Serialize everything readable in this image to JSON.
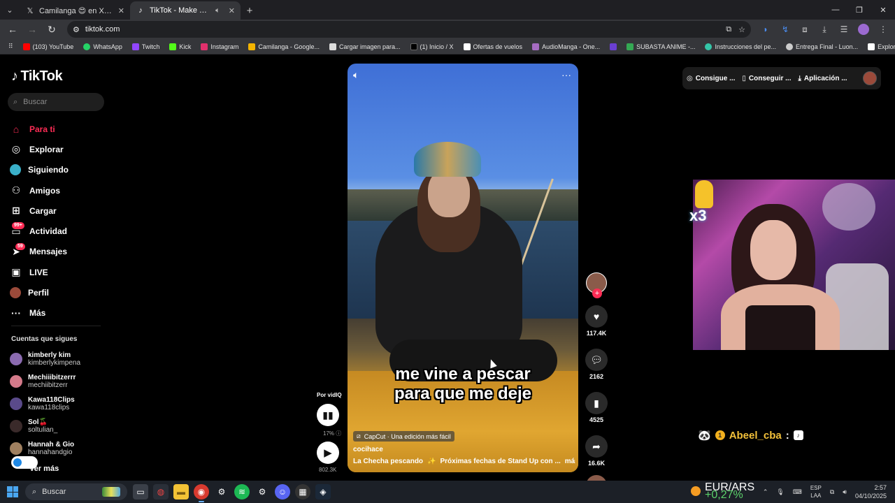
{
  "browser": {
    "tabs": [
      {
        "label": "Camilanga 😍 en X: \"las nudes",
        "icon": "x-logo-icon",
        "active": false
      },
      {
        "label": "TikTok - Make Your Day",
        "icon": "tiktok-icon",
        "active": true
      }
    ],
    "url": "tiktok.com",
    "bookmarks": [
      {
        "label": "(103) YouTube",
        "color": "#ff0000"
      },
      {
        "label": "WhatsApp",
        "color": "#25d366"
      },
      {
        "label": "Twitch",
        "color": "#9146ff"
      },
      {
        "label": "Kick",
        "color": "#53fc18"
      },
      {
        "label": "Instagram",
        "color": "#e1306c"
      },
      {
        "label": "Camilanga - Google...",
        "color": "#f4b400"
      },
      {
        "label": "Cargar imagen para...",
        "color": "#dddddd"
      },
      {
        "label": "(1) Inicio / X",
        "color": "#000000"
      },
      {
        "label": "Ofertas de vuelos",
        "color": "#ffffff"
      },
      {
        "label": "AudioManga - One...",
        "color": "#a56cc1"
      },
      {
        "label": "",
        "color": "#6a3fd1"
      },
      {
        "label": "SUBASTA ANIME -...",
        "color": "#34a853"
      },
      {
        "label": "Instrucciones del pe...",
        "color": "#34c6a8"
      },
      {
        "label": "Entrega Final - Luon...",
        "color": "#cccccc"
      },
      {
        "label": "Explorar | Patreon",
        "color": "#ffffff"
      }
    ]
  },
  "tiktok": {
    "logo": "TikTok",
    "search_placeholder": "Buscar",
    "nav": [
      {
        "label": "Para ti",
        "icon": "home-icon",
        "active": true,
        "badge": ""
      },
      {
        "label": "Explorar",
        "icon": "compass-icon",
        "active": false,
        "badge": ""
      },
      {
        "label": "Siguiendo",
        "icon": "following-icon",
        "active": false,
        "badge": ""
      },
      {
        "label": "Amigos",
        "icon": "friends-icon",
        "active": false,
        "badge": ""
      },
      {
        "label": "Cargar",
        "icon": "upload-icon",
        "active": false,
        "badge": ""
      },
      {
        "label": "Actividad",
        "icon": "activity-icon",
        "active": false,
        "badge": "99+"
      },
      {
        "label": "Mensajes",
        "icon": "messages-icon",
        "active": false,
        "badge": "59"
      },
      {
        "label": "LIVE",
        "icon": "live-icon",
        "active": false,
        "badge": ""
      },
      {
        "label": "Perfil",
        "icon": "profile-icon",
        "active": false,
        "badge": ""
      },
      {
        "label": "Más",
        "icon": "more-icon",
        "active": false,
        "badge": ""
      }
    ],
    "following_heading": "Cuentas que sigues",
    "following": [
      {
        "name": "kimberly kim",
        "handle": "kimberlykimpena",
        "color": "#8b6bb0"
      },
      {
        "name": "Mechiiibitzerrr",
        "handle": "mechiibitzerr",
        "color": "#d47a8a"
      },
      {
        "name": "Kawa118Clips",
        "handle": "kawa118clips",
        "color": "#5a4a8a"
      },
      {
        "name": "Sol🍒",
        "handle": "soltulian_",
        "color": "#2a1a1a"
      },
      {
        "name": "Hannah & Gio",
        "handle": "hannahandgio",
        "color": "#a08060"
      }
    ],
    "see_more": "Ver más",
    "top_actions": [
      "Consigue ...",
      "Conseguir ...",
      "Aplicación ..."
    ],
    "video": {
      "caption_line1": "me vine a pescar",
      "caption_line2": "para que me deje",
      "capcut": "CapCut · Una edición más fácil",
      "author": "cocihace",
      "description_1": "La Checha pescando",
      "description_2": "Próximas fechas de Stand Up con ...",
      "more": "más"
    },
    "actions": {
      "likes": "117.4K",
      "comments": "2162",
      "saves": "4525",
      "shares": "16.6K"
    },
    "vidiq": {
      "label": "Por vidIQ",
      "percent": "17%",
      "views": "802.3K"
    }
  },
  "stream_overlay": {
    "multiplier": "x3",
    "chat_user": "Abeel_cba",
    "chat_sep": ":"
  },
  "taskbar": {
    "search_placeholder": "Buscar",
    "ticker_pair": "EUR/ARS",
    "ticker_change": "+0,27%",
    "lang_1": "ESP",
    "lang_2": "LAA",
    "time": "2:57",
    "date": "04/10/2025"
  }
}
